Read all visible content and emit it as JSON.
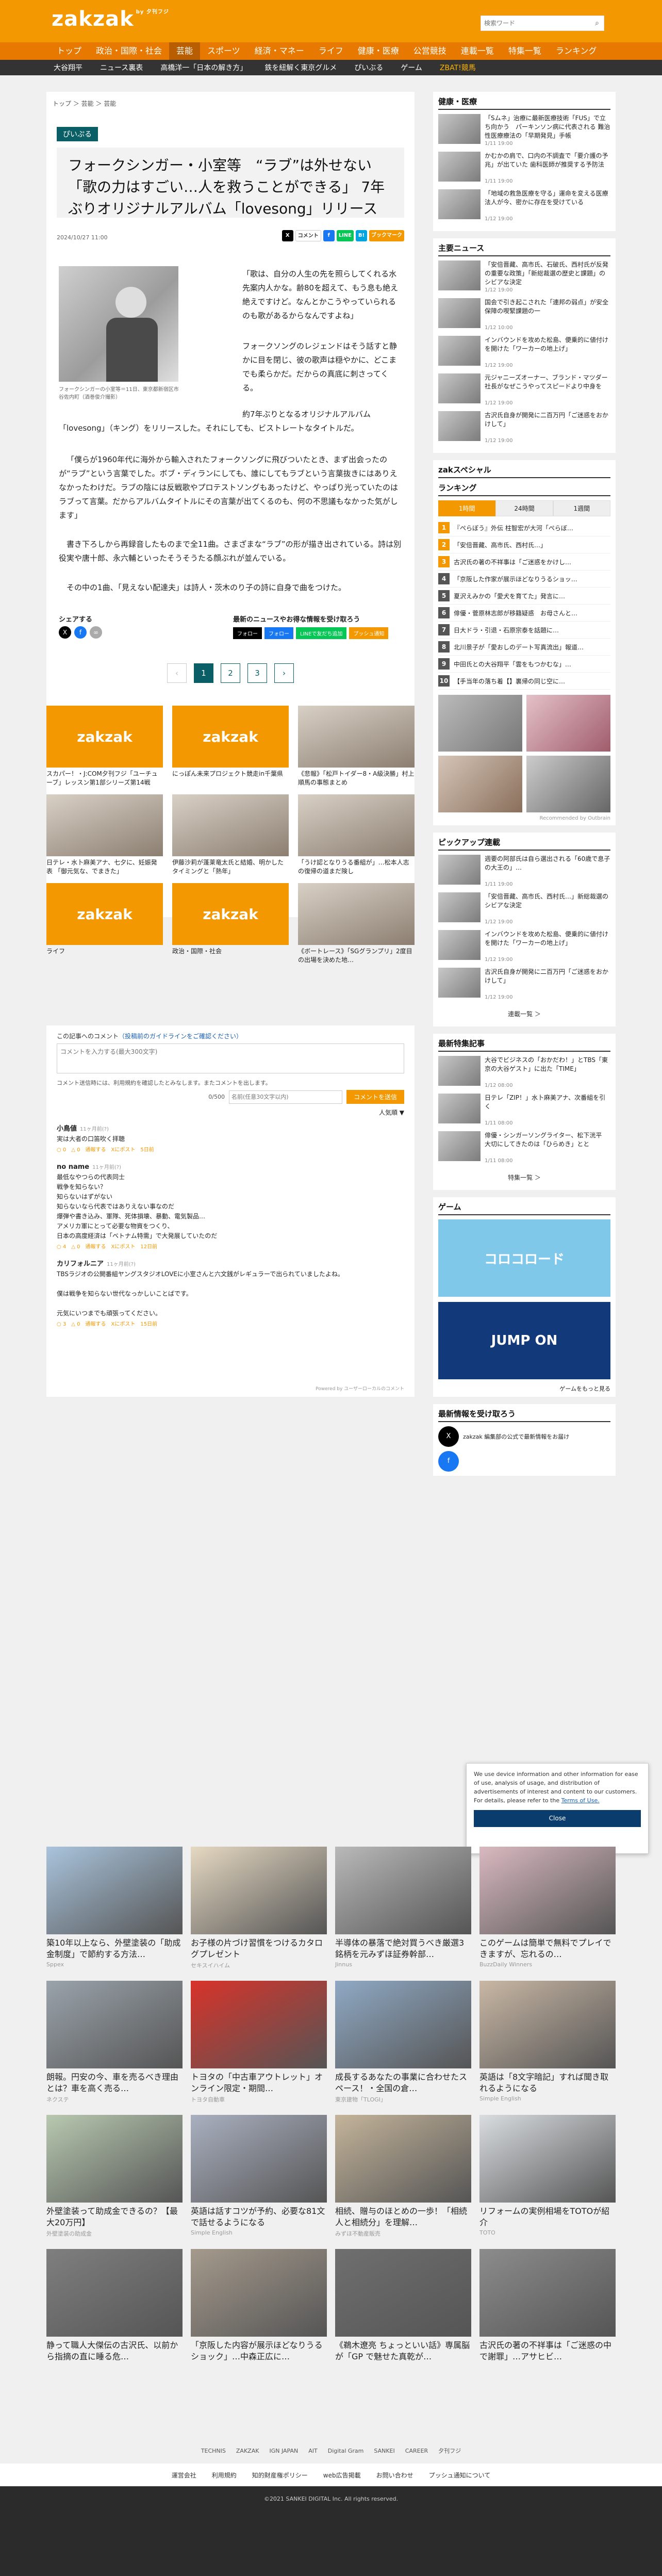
{
  "site": {
    "logo": "zakzak",
    "logo_sub": "by 夕刊フジ",
    "search_placeholder": "検索ワード"
  },
  "nav": [
    "トップ",
    "政治・国際・社会",
    "芸能",
    "スポーツ",
    "経済・マネー",
    "ライフ",
    "健康・医療",
    "公営競技",
    "連載一覧",
    "特集一覧",
    "ランキング"
  ],
  "subnav": [
    "大谷翔平",
    "ニュース裏表",
    "高橋洋一「日本の解き方」",
    "鉄を紐解く東京グルメ",
    "ぴいぶる",
    "ゲーム",
    "ZBAT!競馬"
  ],
  "crumb": "トップ ＞ 芸能 ＞ 芸能",
  "tag": "ぴいぷる",
  "title": "フォークシンガー・小室等　“ラブ”は外せない「歌の力はすごい…人を救うことができる」 7年ぶりオリジナルアルバム「lovesong」リリース",
  "date": "2024/10/27 11:00",
  "share": {
    "x": "X",
    "comment": "コメント",
    "fb": "f",
    "line": "LINE",
    "hatena": "B!",
    "bookmark": "ブックマーク"
  },
  "caption": "フォークシンガーの小室等＝11日、東京都新宿区市谷佐内町（酒巻俊介撮影）",
  "paras": [
    "「歌は、自分の人生の先を照らしてくれる水先案内人かな。齢80を超えて、もう息も絶え絶えですけど。なんとかこうやっていられるのも歌があるからなんですよね」",
    "フォークソングのレジェンドはそう話すと静かに目を閉じ、彼の歌声は穏やかに、どこまでも柔らかだ。だからの真底に刺さってくる。",
    "約7年ぶりとなるオリジナルアルバム「lovesong」（キング）をリリースした。それにしても、ビストレートなタイトルだ。",
    "「僕らが1960年代に海外から輸入されたフォークソングに飛びついたとき、まず出会ったのが“ラブ”という言葉でした。ボブ・ディランにしても、誰にしてもラブという言葉抜きにはありえなかったわけだ。ラブの陰には反戦歌やプロテストソングもあったけど、やっぱり光っていたのはラブって言葉。だからアルバムタイトルにその言葉が出てくるのも、何の不思議もなかった気がします」",
    "書き下ろしから再録音したものまで全11曲。さまざまな“ラブ”の形が描き出されている。詩は別役実や唐十郎、永六輔といったそうそうたる顔ぶれが並んでいる。",
    "その中の1曲、「見えない配達夫」は詩人・茨木のり子の詩に自身で曲をつけた。"
  ],
  "share_label": "シェアする",
  "follow_label": "最新のニュースやお得な情報を受け取ろう",
  "follow_btns": [
    "フォロー",
    "フォロー",
    "LINEで友だち追加",
    "プッシュ通知"
  ],
  "pager": [
    "‹",
    "1",
    "2",
    "3",
    "›"
  ],
  "ads": [
    {
      "t": "スカパー！・J:COM夕刊フジ「ユーチューブ」レッスン第1部シリーズ第14戦",
      "kind": "logo"
    },
    {
      "t": "にっぽん未来プロジェクト競走in千葉県",
      "kind": "logo"
    },
    {
      "t": "《悲報》「松戸トイダー8・A級決勝」村上順馬の事態まとめ",
      "kind": "photo"
    },
    {
      "t": "日テレ・水卜麻美アナ、七夕に、妊娠発表 「御元気な、でまきた」",
      "kind": "photo"
    },
    {
      "t": "伊藤沙莉が蓬莱竜太氏と結婚、明かしたタイミングと「熱年」",
      "kind": "photo"
    },
    {
      "t": "「うけ認となりうる番組が」…松本人志の復帰の道まだ険し",
      "kind": "photo"
    },
    {
      "t": "ライフ",
      "kind": "logo"
    },
    {
      "t": "政治・国際・社会",
      "kind": "logo"
    },
    {
      "t": "《ボートレース》「SGグランプリ」2度目の出場を決めた地…",
      "kind": "photo"
    }
  ],
  "comments": {
    "head": "この記事へのコメント",
    "guide": "（投稿前のガイドラインをご確認ください）",
    "placeholder": "コメントを入力する(最大300文字)",
    "note": "コメント送信時には、利用規約を確認したとみなします。またコメントを出します。",
    "count": "0/500",
    "name_ph": "名前(任意30文字以内)",
    "send": "コメントを送信",
    "sort": "人気順 ▼",
    "items": [
      {
        "n": "小鳥値",
        "time": "11ヶ月前(?)",
        "body": "実は大者の口笛吹く拝聴",
        "meta": "○ 0　△ 0　通報する　Xにポスト　5日前"
      },
      {
        "n": "no name",
        "time": "11ヶ月前(?)",
        "body": "最低なやつらの代表同士\n戦争を知らない？\n知らないはずがない\n知らないなら代表ではありえない事なのだ\n爆弾や書き込み、軍隊、死体損壊、暴動、電気製品…\nアメリカ軍にとって必要な物資をつくり、\n日本の高度経済は「ベトナム特需」で大発展していたのだ",
        "meta": "○ 4　△ 0　通報する　Xにポスト　12日前"
      },
      {
        "n": "カリフォルニア",
        "time": "11ヶ月前(?)",
        "body": "TBSラジオの公開番組ヤングスタジオLOVEに小室さんと六文銭がレギュラーで出られていましたよね。\n\n僕は戦争を知らない世代なっかしいことばです。\n\n元気にいつまでも頑張ってください。",
        "meta": "○ 3　△ 0　通報する　Xにポスト　15日前"
      }
    ],
    "powered": "Powered by ユーザーローカルのコメント"
  },
  "side": {
    "health_title": "健康・医療",
    "health": [
      {
        "t": "「Sムネ」治療に最新医療技術「FUS」で立ち向かう　パーキンソン病に代表される 難治性医療療法の「早期発見」手帳",
        "tm": "1/11 19:00"
      },
      {
        "t": "かむかの肩で、口内の不調査で「要介護の予兆」が出ていた 歯科医師が推奨する予防法",
        "tm": "1/11 19:00"
      },
      {
        "t": "「地域の救急医療を守る」運命を変える医療法人が今、密かに存在を受けている",
        "tm": "1/12 19:00"
      }
    ],
    "main_title": "主要ニュース",
    "main": [
      {
        "t": "「安倍晋藏、高市氏、石破氏、西村氏が反発の重要な政策」「新総裁選の歴史と課題」のシビアな決定",
        "tm": "1/12 19:00"
      },
      {
        "t": "国会で引き起こされた「連邦の弱点」が安全保障の喫緊課題の一",
        "tm": "1/12 10:00"
      },
      {
        "t": "インバウンドを攻めた松島、便乗的に値付けを開けた「ワーカーの地上げ」",
        "tm": "1/12 19:00"
      },
      {
        "t": "元ジャニーズオーナー、ブランド・マツダー社長がなぜこうやってスピードより中身を",
        "tm": "1/12 19:00"
      },
      {
        "t": "古沢氏自身が開発に二百万円「ご迷惑をおかけして」",
        "tm": "1/12 19:00"
      }
    ],
    "zak_title": "zakスペシャル",
    "rank_title": "ランキング",
    "rank_tabs": [
      "1時間",
      "24時間",
      "1週間"
    ],
    "rank": [
      "『ぺらぼう』外伝 柱智宏が大河「ぺらぼ…",
      "「安倍晋藏、高市氏、西村氏…」",
      "古沢氏の著の不祥事は「ご迷惑をかけし…",
      "「京阪した作家が展示ほどなりうるショッ…",
      "夏沢えみかの「愛犬を育てた」発言に…",
      "俳優・菅原林志郎が移籍疑惑　お母さんと…",
      "日大ドラ・引退・石原宗泰を話題に…",
      "北川景子が「愛おしのデート写真流出」報道…",
      "中田氏との大谷翔平「雲をもつかむな」…",
      "【手当年の落ち着【】裏帰の同じ空に…"
    ],
    "rank_more": "Recommended by Outbrain",
    "pick_title": "ピックアップ連載",
    "pick": [
      {
        "t": "週要の阿部氏は自ら選出される「60歳で息子の大王の」…",
        "tm": "1/11 19:00"
      },
      {
        "t": "「安倍晋藏、高市氏、西村氏…」新総裁選のシビアな決定",
        "tm": "1/12 19:00"
      },
      {
        "t": "インバウンドを攻めた松島、便乗的に値付けを開けた「ワーカーの地上げ」",
        "tm": "1/12 19:00"
      },
      {
        "t": "古沢氏自身が開発に二百万円「ご迷惑をおかけして」",
        "tm": "1/12 19:00"
      }
    ],
    "pick_more": "連載一覧 ＞",
    "feat_title": "最新特集記事",
    "feat": [
      {
        "t": "大谷でビジネスの「おかだわ！」とTBS「東京の大谷ゲスト」に出た「TIME」",
        "tm": "1/12 08:00"
      },
      {
        "t": "日テレ「ZIP！」水卜麻美アナ、次番組を引く",
        "tm": "1/11 08:00"
      },
      {
        "t": "俳優・シンガーソングライター、松下洸平　大切にしてきたのは「ひらめき」とと",
        "tm": "1/11 08:00"
      }
    ],
    "feat_more": "特集一覧 ＞",
    "game_title": "ゲーム",
    "games": [
      "コロコロード",
      "JUMP ON"
    ],
    "game_more": "ゲームをもっと見る",
    "recv_title": "最新情報を受け取ろう",
    "recv_text": "zakzak 編集部の公式で最新情報をお届け"
  },
  "cookie": {
    "text": "We use device information and other information for ease of use, analysis of usage, and distribution of advertisements of interest and content to our customers. For details, please refer to the ",
    "link": "Terms of Use.",
    "btn": "Close"
  },
  "bottom": [
    {
      "t": "築10年以上なら、外壁塗装の「助成金制度」で節約する方法…",
      "s": "Sppex"
    },
    {
      "t": "お子様の片づけ習慣をつけるカタログプレゼント",
      "s": "セキスイハイム"
    },
    {
      "t": "半導体の暴落で絶対買うべき厳選3銘柄を元みずほ証券幹部…",
      "s": "Jinnus"
    },
    {
      "t": "このゲームは簡単で無料でプレイできますが、忘れるの…",
      "s": "BuzzDaily Winners"
    },
    {
      "t": "朗報。円安の今、車を売るべき理由とは？車を高く売る…",
      "s": "ネクステ"
    },
    {
      "t": "トヨタの「中古車アウトレット」オンライン限定・期間…",
      "s": "トヨタ自動車"
    },
    {
      "t": "成長するあなたの事業に合わせたスペース！・全国の倉…",
      "s": "東京建物「TLOGI」"
    },
    {
      "t": "英語は「8文字暗記」すれば聞き取れるようになる",
      "s": "Simple English"
    },
    {
      "t": "外壁塗装って助成金できるの？【最大20万円】",
      "s": "外壁塗装の助成金"
    },
    {
      "t": "英語は話すコツが予約、必要な81文で話せるようになる",
      "s": "Simple English"
    },
    {
      "t": "相続、贈与のほとめの一歩！「相続人と相続分」を理解…",
      "s": "みずほ不動産販売"
    },
    {
      "t": "リフォームの実例相場をTOTOが紹介",
      "s": "TOTO"
    },
    {
      "t": "静って職人大傑伝の古沢氏、以前から指摘の直に睡る危…",
      "s": ""
    },
    {
      "t": "「京阪した内容が展示ほどなりうるショック」…中森正広に…",
      "s": ""
    },
    {
      "t": "《鵜木遼亮 ちょっといい話》専属脳が「GP で魅せた真乾が…",
      "s": ""
    },
    {
      "t": "古沢氏の著の不祥事は「ご迷惑の中で謝罪」…アサヒビ…",
      "s": ""
    }
  ],
  "partners": [
    "TECHNIS",
    "ZAKZAK",
    "IGN JAPAN",
    "AIT",
    "Digital Gram",
    "SANKEI",
    "CAREER",
    "夕刊フジ"
  ],
  "footer": [
    "運営会社",
    "利用規約",
    "知的財産権ポリシー",
    "web広告掲載",
    "お問い合わせ",
    "プッシュ通知について"
  ],
  "copyright": "©2021 SANKEI DIGITAL Inc. All rights reserved.",
  "colors": {
    "brand": "#f39800",
    "accent": "#0a5f66"
  }
}
